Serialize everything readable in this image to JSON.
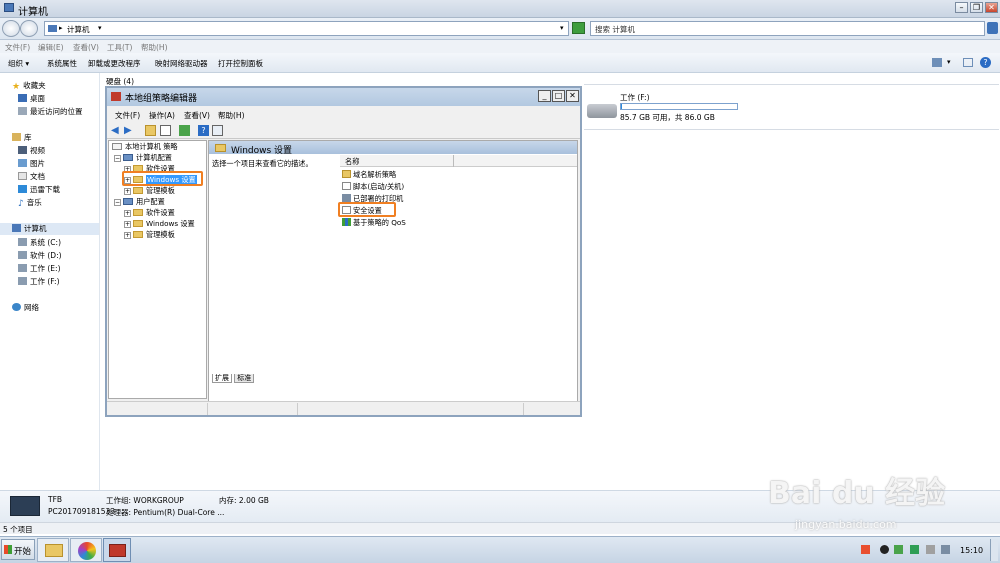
{
  "explorer": {
    "title": "计算机",
    "address": "计算机",
    "search_placeholder": "搜索 计算机",
    "menu": [
      "文件(F)",
      "编辑(E)",
      "查看(V)",
      "工具(T)",
      "帮助(H)"
    ],
    "toolbar": [
      "组织 ▾",
      "系统属性",
      "卸载或更改程序",
      "映射网络驱动器",
      "打开控制面板"
    ],
    "nav": {
      "favorites": "收藏夹",
      "desktop": "桌面",
      "recent": "最近访问的位置",
      "libraries": "库",
      "videos": "视频",
      "pictures": "图片",
      "documents": "文档",
      "thunder": "迅雷下载",
      "music": "音乐",
      "computer": "计算机",
      "drives": [
        "系统 (C:)",
        "软件 (D:)",
        "工作 (E:)",
        "工作 (F:)"
      ],
      "network": "网络"
    },
    "group_header": "硬盘 (4)",
    "drive_f": {
      "name": "工作 (F:)",
      "free": "85.7 GB 可用，共 86.0 GB",
      "used_fraction": 0.0035
    },
    "details": {
      "computer_name": "TFB",
      "full_name": "PC201709181533",
      "workgroup": "工作组: WORKGROUP",
      "processor": "处理器: Pentium(R) Dual-Core ...",
      "memory": "内存: 2.00 GB"
    },
    "status": "5 个项目"
  },
  "gpe": {
    "title": "本地组策略编辑器",
    "menu": [
      "文件(F)",
      "操作(A)",
      "查看(V)",
      "帮助(H)"
    ],
    "tree": {
      "root": "本地计算机 策略",
      "computer_config": "计算机配置",
      "software_settings": "软件设置",
      "windows_settings": "Windows 设置",
      "admin_templates": "管理模板",
      "user_config": "用户配置",
      "u_software_settings": "软件设置",
      "u_windows_settings": "Windows 设置",
      "u_admin_templates": "管理模板"
    },
    "right_header": "Windows 设置",
    "description": "选择一个项目来查看它的描述。",
    "column_name": "名称",
    "items": [
      "域名解析策略",
      "脚本(启动/关机)",
      "已部署的打印机",
      "安全设置",
      "基于策略的 QoS"
    ],
    "tabs": [
      "扩展",
      "标准"
    ]
  },
  "taskbar": {
    "start": "开始",
    "time": "15:10"
  },
  "watermark": {
    "brand": "Bai du 经验",
    "url": "jingyan.baidu.com"
  },
  "colors": {
    "highlight": "#f07f22",
    "selection": "#3399ff",
    "title_gradient": "#b2c8e0"
  }
}
